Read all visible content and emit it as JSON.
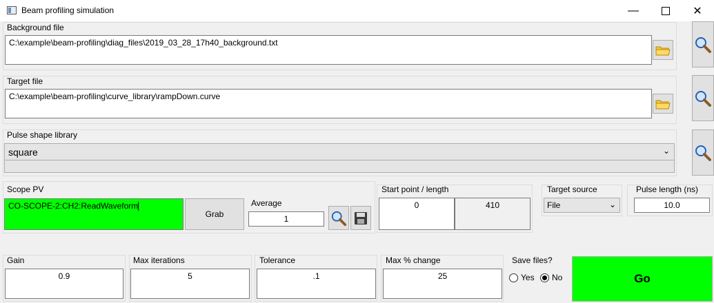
{
  "window": {
    "title": "Beam profiling simulation"
  },
  "background_file": {
    "label": "Background file",
    "path": "C:\\example\\beam-profiling\\diag_files\\2019_03_28_17h40_background.txt"
  },
  "target_file": {
    "label": "Target file",
    "path": "C:\\example\\beam-profiling\\curve_library\\rampDown.curve"
  },
  "pulse_library": {
    "label": "Pulse shape library",
    "selected": "square"
  },
  "scope": {
    "label": "Scope PV",
    "pv": "CO-SCOPE-2:CH2:ReadWaveform",
    "grab_label": "Grab",
    "average_label": "Average",
    "average_value": "1"
  },
  "start_point": {
    "label": "Start point / length",
    "start": "0",
    "length": "410"
  },
  "target_source": {
    "label": "Target source",
    "selected": "File"
  },
  "pulse_length": {
    "label": "Pulse length (ns)",
    "value": "10.0"
  },
  "gain": {
    "label": "Gain",
    "value": "0.9"
  },
  "max_iterations": {
    "label": "Max iterations",
    "value": "5"
  },
  "tolerance": {
    "label": "Tolerance",
    "value": ".1"
  },
  "max_change": {
    "label": "Max % change",
    "value": "25"
  },
  "save_files": {
    "label": "Save files?",
    "yes_label": "Yes",
    "no_label": "No",
    "selected": "No"
  },
  "go_label": "Go",
  "colors": {
    "pv_background": "#00ff00",
    "go_background": "#00ff00"
  },
  "icons": [
    "minimize-icon",
    "maximize-icon",
    "close-icon",
    "folder-icon",
    "magnifier-icon",
    "save-disk-icon",
    "chevron-down-icon"
  ]
}
